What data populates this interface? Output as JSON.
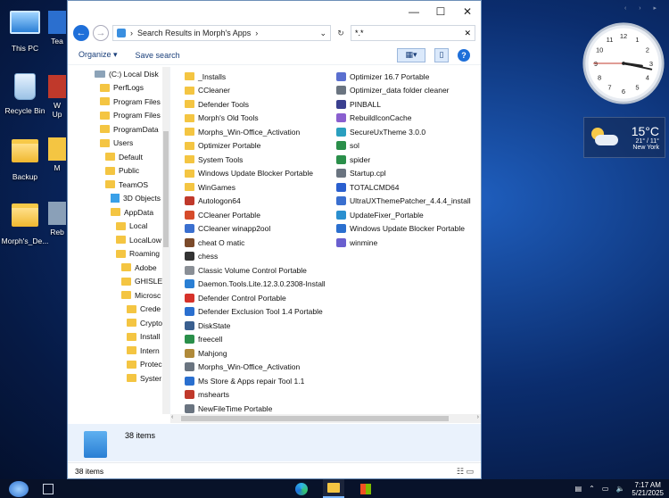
{
  "desktop": {
    "icons": [
      {
        "label": "This PC"
      },
      {
        "label": "Recycle Bin"
      },
      {
        "label": "Backup"
      },
      {
        "label": "Morph's_De..."
      }
    ],
    "partial_icons": [
      {
        "label": "Tea"
      },
      {
        "label": "W"
      },
      {
        "label": "Up"
      },
      {
        "label": "M"
      },
      {
        "label": "Reb"
      }
    ]
  },
  "window": {
    "controls": {
      "minimize": "—",
      "maximize": "☐",
      "close": "✕"
    },
    "address": {
      "path": "Search Results in Morph's Apps",
      "chevron": "›"
    },
    "search": {
      "value": "*.*",
      "clear": "✕"
    },
    "toolbar": {
      "organize": "Organize ▾",
      "save_search": "Save search",
      "help": "?"
    },
    "nav_tree": [
      {
        "label": "(C:) Local Disk",
        "indent": 0,
        "type": "drive"
      },
      {
        "label": "PerfLogs",
        "indent": 1,
        "type": "folder"
      },
      {
        "label": "Program Files",
        "indent": 1,
        "type": "folder"
      },
      {
        "label": "Program Files",
        "indent": 1,
        "type": "folder"
      },
      {
        "label": "ProgramData",
        "indent": 1,
        "type": "folder"
      },
      {
        "label": "Users",
        "indent": 1,
        "type": "folder"
      },
      {
        "label": "Default",
        "indent": 2,
        "type": "folder"
      },
      {
        "label": "Public",
        "indent": 2,
        "type": "folder"
      },
      {
        "label": "TeamOS",
        "indent": 2,
        "type": "folder"
      },
      {
        "label": "3D Objects",
        "indent": 3,
        "type": "cube"
      },
      {
        "label": "AppData",
        "indent": 3,
        "type": "folder"
      },
      {
        "label": "Local",
        "indent": 4,
        "type": "folder"
      },
      {
        "label": "LocalLow",
        "indent": 4,
        "type": "folder"
      },
      {
        "label": "Roaming",
        "indent": 4,
        "type": "folder"
      },
      {
        "label": "Adobe",
        "indent": 5,
        "type": "folder"
      },
      {
        "label": "GHISLEI",
        "indent": 5,
        "type": "folder"
      },
      {
        "label": "Microsc",
        "indent": 5,
        "type": "folder"
      },
      {
        "label": "Crede",
        "indent": 6,
        "type": "folder"
      },
      {
        "label": "Crypto",
        "indent": 6,
        "type": "folder"
      },
      {
        "label": "Install",
        "indent": 6,
        "type": "folder"
      },
      {
        "label": "Intern",
        "indent": 6,
        "type": "folder"
      },
      {
        "label": "Protec",
        "indent": 6,
        "type": "folder"
      },
      {
        "label": "Syster",
        "indent": 6,
        "type": "folder"
      }
    ],
    "files_col1": [
      {
        "name": "_Installs",
        "icon": "folder",
        "color": "#f4c542"
      },
      {
        "name": "CCleaner",
        "icon": "folder",
        "color": "#f4c542"
      },
      {
        "name": "Defender Tools",
        "icon": "folder",
        "color": "#f4c542"
      },
      {
        "name": "Morph's Old Tools",
        "icon": "folder",
        "color": "#f4c542"
      },
      {
        "name": "Morphs_Win-Office_Activation",
        "icon": "folder",
        "color": "#f4c542"
      },
      {
        "name": "Optimizer Portable",
        "icon": "folder",
        "color": "#f4c542"
      },
      {
        "name": "System Tools",
        "icon": "folder",
        "color": "#f4c542"
      },
      {
        "name": "Windows Update Blocker Portable",
        "icon": "folder",
        "color": "#f4c542"
      },
      {
        "name": "WinGames",
        "icon": "folder",
        "color": "#f4c542"
      },
      {
        "name": "Autologon64",
        "icon": "app",
        "color": "#c0392b"
      },
      {
        "name": "CCleaner Portable",
        "icon": "app",
        "color": "#d64b2a"
      },
      {
        "name": "CCleaner winapp2ool",
        "icon": "app",
        "color": "#3a6fcf"
      },
      {
        "name": "cheat O matic",
        "icon": "app",
        "color": "#7b4a2a"
      },
      {
        "name": "chess",
        "icon": "app",
        "color": "#333333"
      },
      {
        "name": "Classic Volume Control Portable",
        "icon": "app",
        "color": "#8a8f96"
      },
      {
        "name": "Daemon.Tools.Lite.12.3.0.2308-Install",
        "icon": "app",
        "color": "#2a7fd4"
      },
      {
        "name": "Defender Control Portable",
        "icon": "app",
        "color": "#d6322a"
      },
      {
        "name": "Defender Exclusion Tool 1.4 Portable",
        "icon": "app",
        "color": "#2a6fcf"
      },
      {
        "name": "DiskState",
        "icon": "app",
        "color": "#3a5f8f"
      },
      {
        "name": "freecell",
        "icon": "app",
        "color": "#2a8f4a"
      },
      {
        "name": "Mahjong",
        "icon": "app",
        "color": "#b08a3a"
      },
      {
        "name": "Morphs_Win-Office_Activation",
        "icon": "app",
        "color": "#6a7480"
      },
      {
        "name": "Ms Store & Apps repair Tool 1.1",
        "icon": "app",
        "color": "#2a6fcf"
      },
      {
        "name": "mshearts",
        "icon": "app",
        "color": "#c0392b"
      },
      {
        "name": "NewFileTime Portable",
        "icon": "app",
        "color": "#6a7480"
      }
    ],
    "files_col2": [
      {
        "name": "Optimizer 16.7 Portable",
        "icon": "app",
        "color": "#5a6fcf"
      },
      {
        "name": "Optimizer_data folder cleaner",
        "icon": "app",
        "color": "#6a7480"
      },
      {
        "name": "PINBALL",
        "icon": "app",
        "color": "#3a3f8f"
      },
      {
        "name": "RebuildIconCache",
        "icon": "app",
        "color": "#8a5fcf"
      },
      {
        "name": "SecureUxTheme 3.0.0",
        "icon": "app",
        "color": "#2a9fbf"
      },
      {
        "name": "sol",
        "icon": "app",
        "color": "#2a8f4a"
      },
      {
        "name": "spider",
        "icon": "app",
        "color": "#2a8f4a"
      },
      {
        "name": "Startup.cpl",
        "icon": "app",
        "color": "#6a7480"
      },
      {
        "name": "TOTALCMD64",
        "icon": "app",
        "color": "#2a5fcf"
      },
      {
        "name": "UltraUXThemePatcher_4.4.4_install",
        "icon": "app",
        "color": "#3a6fcf"
      },
      {
        "name": "UpdateFixer_Portable",
        "icon": "app",
        "color": "#2a8fcf"
      },
      {
        "name": "Windows Update Blocker Portable",
        "icon": "app",
        "color": "#2a6fcf"
      },
      {
        "name": "winmine",
        "icon": "app",
        "color": "#6a5fcf"
      }
    ],
    "details": {
      "count": "38 items"
    },
    "status": {
      "count": "38 items"
    }
  },
  "widgets": {
    "clock": {
      "hour": 3,
      "minute": 17,
      "second": 45
    },
    "weather": {
      "temp": "15°C",
      "range": "21° / 11°",
      "city": "New York"
    }
  },
  "taskbar": {
    "time": "7:17 AM",
    "date": "5/21/2025"
  }
}
